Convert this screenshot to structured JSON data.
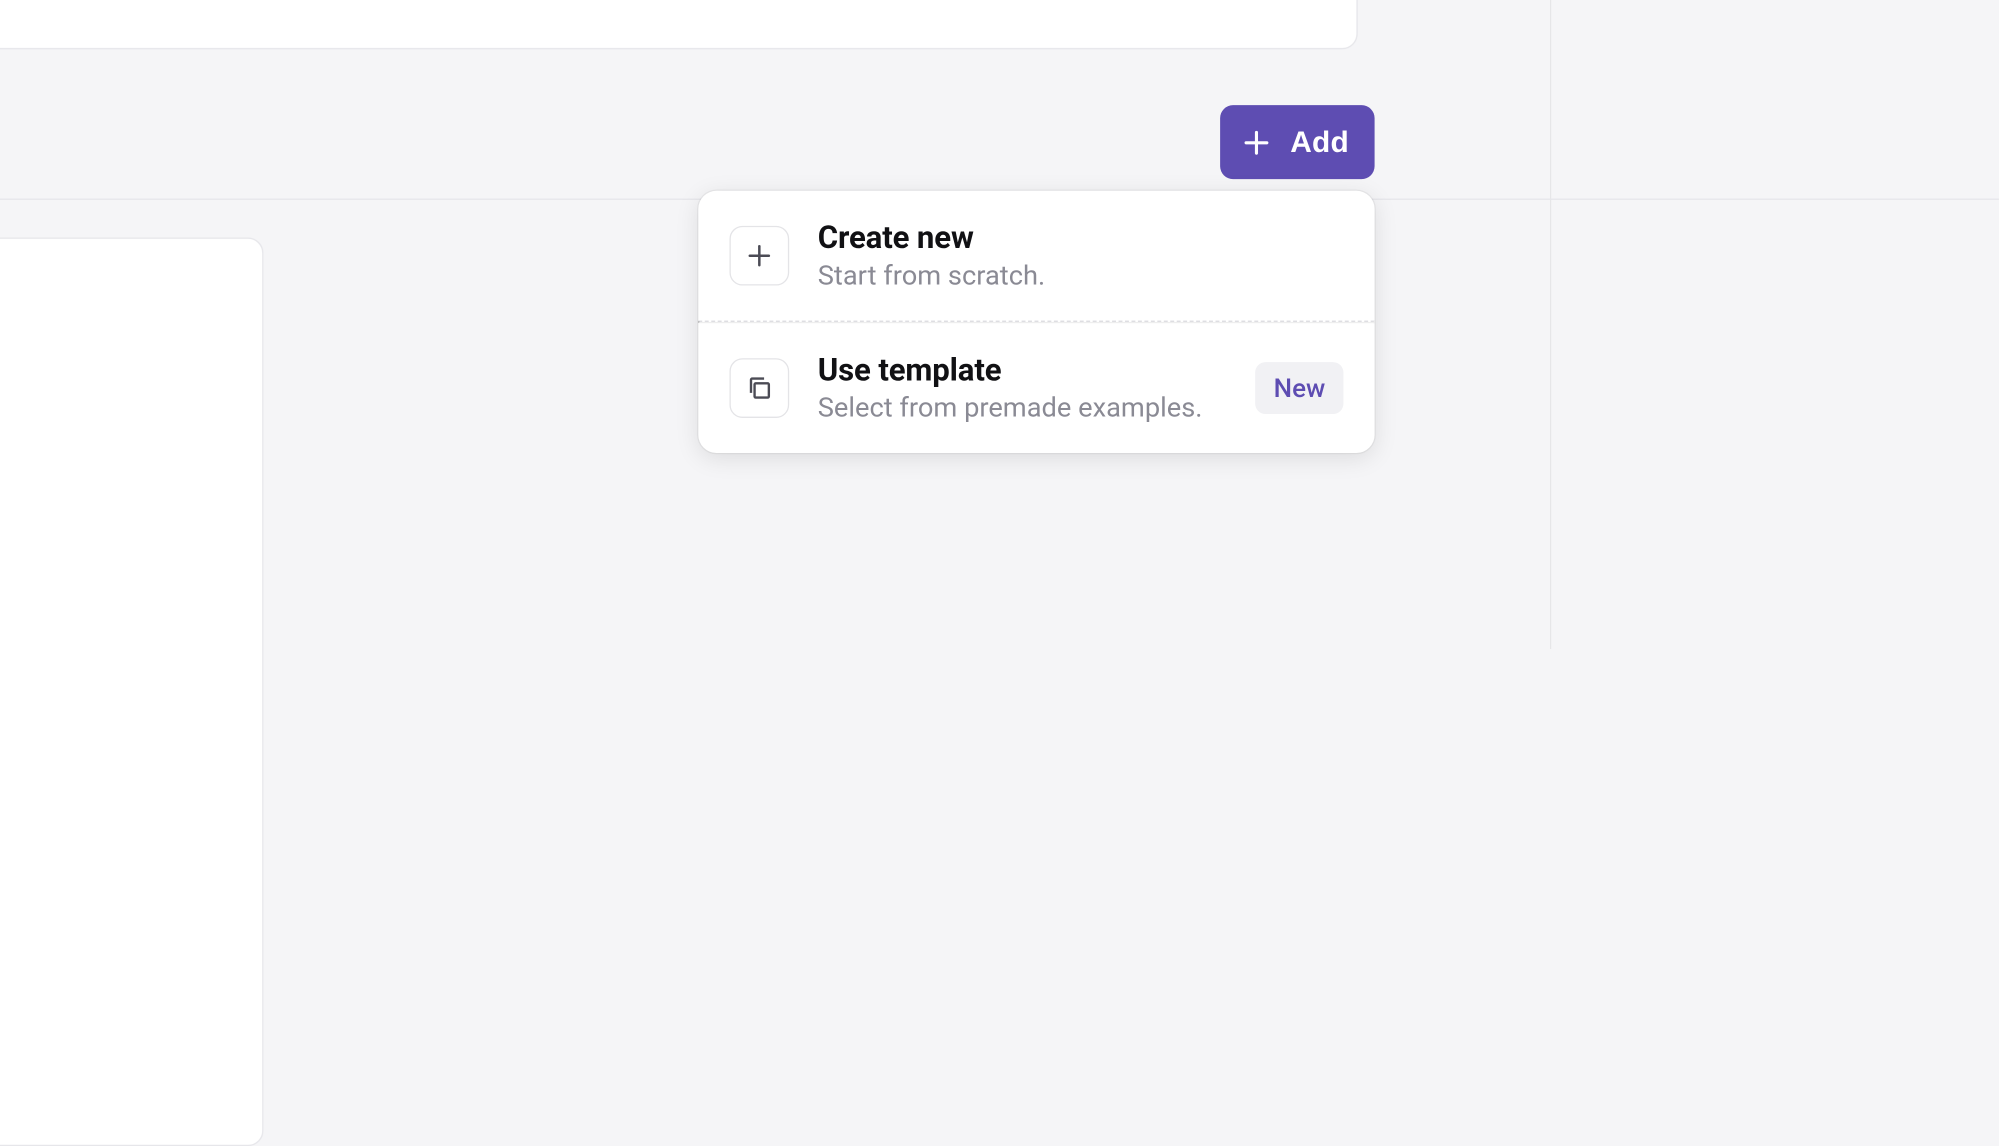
{
  "add_button": {
    "label": "Add"
  },
  "menu": {
    "create": {
      "title": "Create new",
      "desc": "Start from scratch."
    },
    "template": {
      "title": "Use template",
      "desc": "Select from premade examples.",
      "badge": "New"
    }
  }
}
